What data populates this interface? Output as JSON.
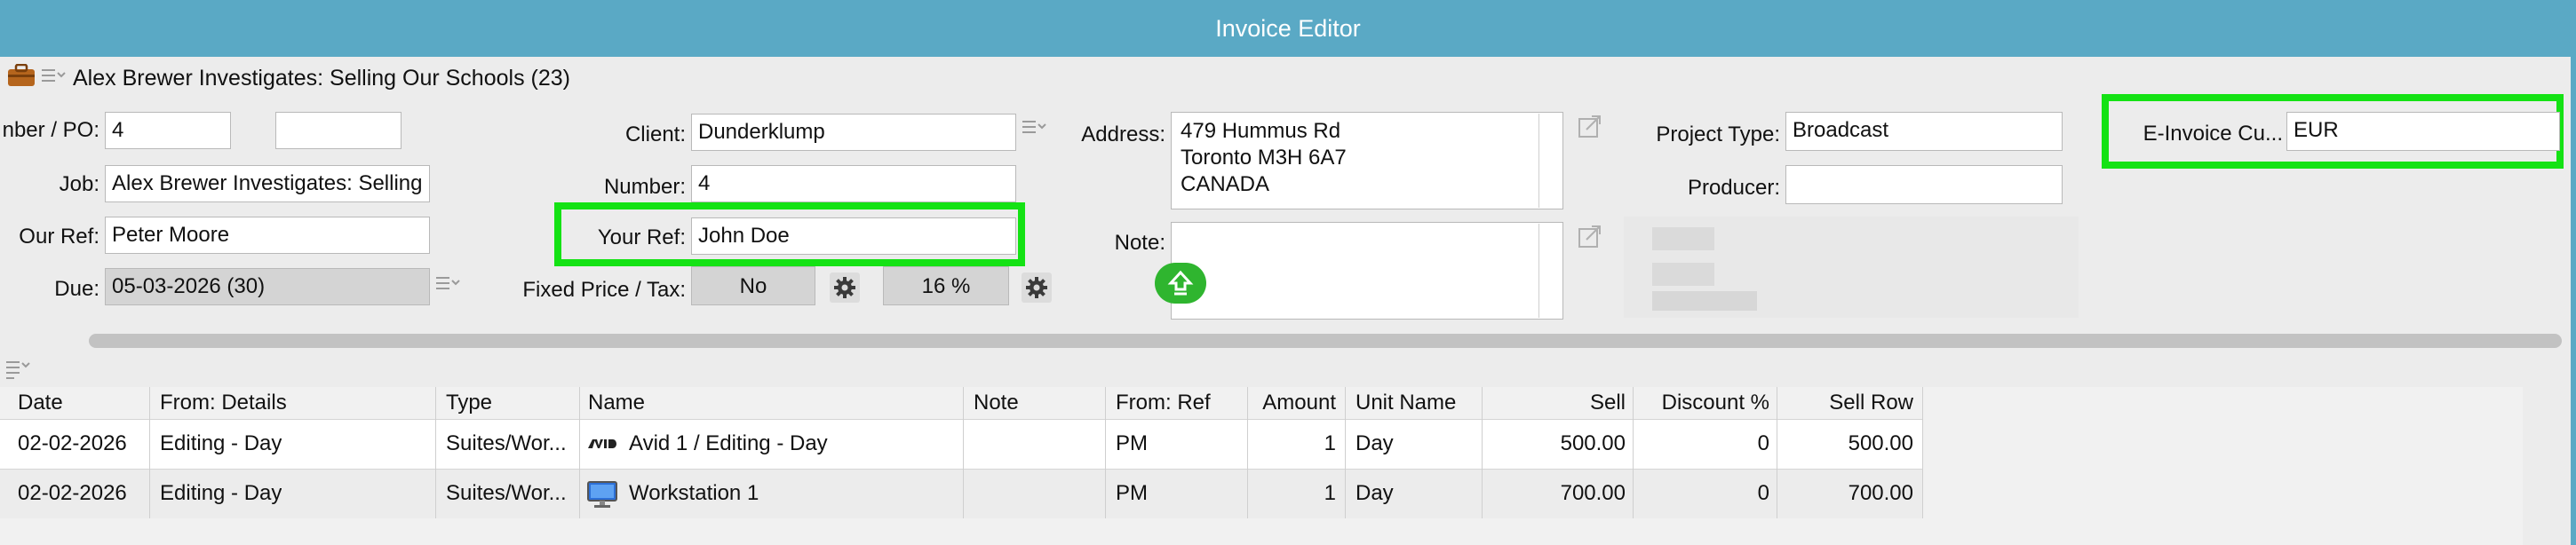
{
  "window": {
    "title": "Invoice Editor"
  },
  "project": {
    "title": "Alex Brewer Investigates: Selling Our Schools (23)"
  },
  "form": {
    "number_po_label": "nber / PO:",
    "number_po_value": "4",
    "number_po_extra": "",
    "job_label": "Job:",
    "job_value": "Alex Brewer Investigates: Selling",
    "our_ref_label": "Our Ref:",
    "our_ref_value": "Peter Moore",
    "due_label": "Due:",
    "due_value": "05-03-2026 (30)",
    "client_label": "Client:",
    "client_value": "Dunderklump",
    "number_label": "Number:",
    "number_value": "4",
    "your_ref_label": "Your Ref:",
    "your_ref_value": "John Doe",
    "fixed_price_tax_label": "Fixed Price / Tax:",
    "fixed_price_value": "No",
    "tax_value": "16 %",
    "address_label": "Address:",
    "address_line1": "479 Hummus Rd",
    "address_line2": "Toronto M3H 6A7",
    "address_line3": "CANADA",
    "note_label": "Note:",
    "project_type_label": "Project Type:",
    "project_type_value": "Broadcast",
    "producer_label": "Producer:",
    "producer_value": "",
    "einvoice_label": "E-Invoice Cu...",
    "einvoice_value": "EUR"
  },
  "table": {
    "columns": [
      "Date",
      "From: Details",
      "Type",
      "Name",
      "Note",
      "From: Ref",
      "Amount",
      "Unit Name",
      "Sell",
      "Discount %",
      "Sell Row"
    ],
    "rows": [
      {
        "date": "02-02-2026",
        "details": "Editing - Day",
        "type": "Suites/Wor...",
        "name": "Avid 1 / Editing - Day",
        "icon": "avid-logo-icon",
        "note": "",
        "ref": "PM",
        "amount": "1",
        "unit": "Day",
        "sell": "500.00",
        "discount": "0",
        "sell_row": "500.00"
      },
      {
        "date": "02-02-2026",
        "details": "Editing - Day",
        "type": "Suites/Wor...",
        "name": "Workstation 1",
        "icon": "monitor-icon",
        "note": "",
        "ref": "PM",
        "amount": "1",
        "unit": "Day",
        "sell": "700.00",
        "discount": "0",
        "sell_row": "700.00"
      }
    ]
  },
  "icons": {
    "briefcase_color": "#b5651d",
    "upload_color": "#2fb52f",
    "highlight_color": "#14e214"
  }
}
